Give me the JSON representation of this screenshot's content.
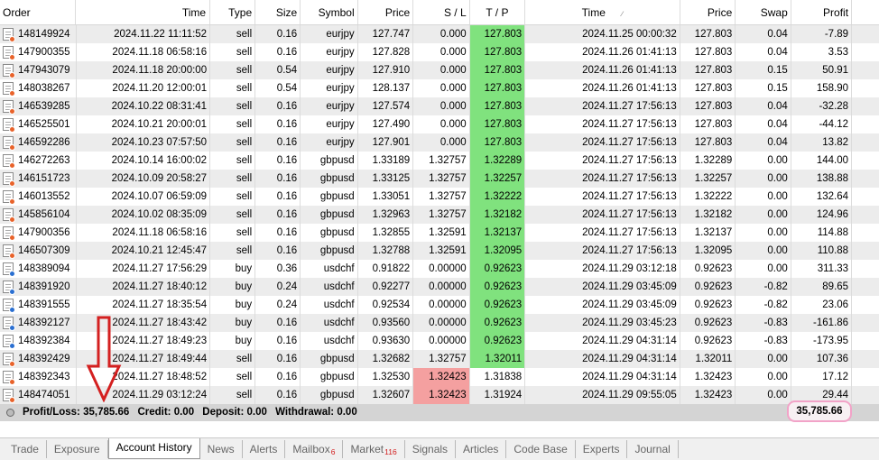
{
  "columns": {
    "order": "Order",
    "open_time": "Time",
    "type": "Type",
    "size": "Size",
    "symbol": "Symbol",
    "open_price": "Price",
    "sl": "S / L",
    "tp": "T / P",
    "close_time": "Time",
    "close_price": "Price",
    "swap": "Swap",
    "profit": "Profit"
  },
  "rows": [
    {
      "order": "148149924",
      "open_time": "2024.11.22 11:11:52",
      "type": "sell",
      "size": "0.16",
      "symbol": "eurjpy",
      "open_price": "127.747",
      "sl": "0.000",
      "tp": "127.803",
      "close_time": "2024.11.25 00:00:32",
      "close_price": "127.803",
      "swap": "0.04",
      "profit": "-7.89",
      "hit": "tp"
    },
    {
      "order": "147900355",
      "open_time": "2024.11.18 06:58:16",
      "type": "sell",
      "size": "0.16",
      "symbol": "eurjpy",
      "open_price": "127.828",
      "sl": "0.000",
      "tp": "127.803",
      "close_time": "2024.11.26 01:41:13",
      "close_price": "127.803",
      "swap": "0.04",
      "profit": "3.53",
      "hit": "tp"
    },
    {
      "order": "147943079",
      "open_time": "2024.11.18 20:00:00",
      "type": "sell",
      "size": "0.54",
      "symbol": "eurjpy",
      "open_price": "127.910",
      "sl": "0.000",
      "tp": "127.803",
      "close_time": "2024.11.26 01:41:13",
      "close_price": "127.803",
      "swap": "0.15",
      "profit": "50.91",
      "hit": "tp"
    },
    {
      "order": "148038267",
      "open_time": "2024.11.20 12:00:01",
      "type": "sell",
      "size": "0.54",
      "symbol": "eurjpy",
      "open_price": "128.137",
      "sl": "0.000",
      "tp": "127.803",
      "close_time": "2024.11.26 01:41:13",
      "close_price": "127.803",
      "swap": "0.15",
      "profit": "158.90",
      "hit": "tp"
    },
    {
      "order": "146539285",
      "open_time": "2024.10.22 08:31:41",
      "type": "sell",
      "size": "0.16",
      "symbol": "eurjpy",
      "open_price": "127.574",
      "sl": "0.000",
      "tp": "127.803",
      "close_time": "2024.11.27 17:56:13",
      "close_price": "127.803",
      "swap": "0.04",
      "profit": "-32.28",
      "hit": "tp"
    },
    {
      "order": "146525501",
      "open_time": "2024.10.21 20:00:01",
      "type": "sell",
      "size": "0.16",
      "symbol": "eurjpy",
      "open_price": "127.490",
      "sl": "0.000",
      "tp": "127.803",
      "close_time": "2024.11.27 17:56:13",
      "close_price": "127.803",
      "swap": "0.04",
      "profit": "-44.12",
      "hit": "tp"
    },
    {
      "order": "146592286",
      "open_time": "2024.10.23 07:57:50",
      "type": "sell",
      "size": "0.16",
      "symbol": "eurjpy",
      "open_price": "127.901",
      "sl": "0.000",
      "tp": "127.803",
      "close_time": "2024.11.27 17:56:13",
      "close_price": "127.803",
      "swap": "0.04",
      "profit": "13.82",
      "hit": "tp"
    },
    {
      "order": "146272263",
      "open_time": "2024.10.14 16:00:02",
      "type": "sell",
      "size": "0.16",
      "symbol": "gbpusd",
      "open_price": "1.33189",
      "sl": "1.32757",
      "tp": "1.32289",
      "close_time": "2024.11.27 17:56:13",
      "close_price": "1.32289",
      "swap": "0.00",
      "profit": "144.00",
      "hit": "tp"
    },
    {
      "order": "146151723",
      "open_time": "2024.10.09 20:58:27",
      "type": "sell",
      "size": "0.16",
      "symbol": "gbpusd",
      "open_price": "1.33125",
      "sl": "1.32757",
      "tp": "1.32257",
      "close_time": "2024.11.27 17:56:13",
      "close_price": "1.32257",
      "swap": "0.00",
      "profit": "138.88",
      "hit": "tp"
    },
    {
      "order": "146013552",
      "open_time": "2024.10.07 06:59:09",
      "type": "sell",
      "size": "0.16",
      "symbol": "gbpusd",
      "open_price": "1.33051",
      "sl": "1.32757",
      "tp": "1.32222",
      "close_time": "2024.11.27 17:56:13",
      "close_price": "1.32222",
      "swap": "0.00",
      "profit": "132.64",
      "hit": "tp"
    },
    {
      "order": "145856104",
      "open_time": "2024.10.02 08:35:09",
      "type": "sell",
      "size": "0.16",
      "symbol": "gbpusd",
      "open_price": "1.32963",
      "sl": "1.32757",
      "tp": "1.32182",
      "close_time": "2024.11.27 17:56:13",
      "close_price": "1.32182",
      "swap": "0.00",
      "profit": "124.96",
      "hit": "tp"
    },
    {
      "order": "147900356",
      "open_time": "2024.11.18 06:58:16",
      "type": "sell",
      "size": "0.16",
      "symbol": "gbpusd",
      "open_price": "1.32855",
      "sl": "1.32591",
      "tp": "1.32137",
      "close_time": "2024.11.27 17:56:13",
      "close_price": "1.32137",
      "swap": "0.00",
      "profit": "114.88",
      "hit": "tp"
    },
    {
      "order": "146507309",
      "open_time": "2024.10.21 12:45:47",
      "type": "sell",
      "size": "0.16",
      "symbol": "gbpusd",
      "open_price": "1.32788",
      "sl": "1.32591",
      "tp": "1.32095",
      "close_time": "2024.11.27 17:56:13",
      "close_price": "1.32095",
      "swap": "0.00",
      "profit": "110.88",
      "hit": "tp"
    },
    {
      "order": "148389094",
      "open_time": "2024.11.27 17:56:29",
      "type": "buy",
      "size": "0.36",
      "symbol": "usdchf",
      "open_price": "0.91822",
      "sl": "0.00000",
      "tp": "0.92623",
      "close_time": "2024.11.29 03:12:18",
      "close_price": "0.92623",
      "swap": "0.00",
      "profit": "311.33",
      "hit": "tp"
    },
    {
      "order": "148391920",
      "open_time": "2024.11.27 18:40:12",
      "type": "buy",
      "size": "0.24",
      "symbol": "usdchf",
      "open_price": "0.92277",
      "sl": "0.00000",
      "tp": "0.92623",
      "close_time": "2024.11.29 03:45:09",
      "close_price": "0.92623",
      "swap": "-0.82",
      "profit": "89.65",
      "hit": "tp"
    },
    {
      "order": "148391555",
      "open_time": "2024.11.27 18:35:54",
      "type": "buy",
      "size": "0.24",
      "symbol": "usdchf",
      "open_price": "0.92534",
      "sl": "0.00000",
      "tp": "0.92623",
      "close_time": "2024.11.29 03:45:09",
      "close_price": "0.92623",
      "swap": "-0.82",
      "profit": "23.06",
      "hit": "tp"
    },
    {
      "order": "148392127",
      "open_time": "2024.11.27 18:43:42",
      "type": "buy",
      "size": "0.16",
      "symbol": "usdchf",
      "open_price": "0.93560",
      "sl": "0.00000",
      "tp": "0.92623",
      "close_time": "2024.11.29 03:45:23",
      "close_price": "0.92623",
      "swap": "-0.83",
      "profit": "-161.86",
      "hit": "tp"
    },
    {
      "order": "148392384",
      "open_time": "2024.11.27 18:49:23",
      "type": "buy",
      "size": "0.16",
      "symbol": "usdchf",
      "open_price": "0.93630",
      "sl": "0.00000",
      "tp": "0.92623",
      "close_time": "2024.11.29 04:31:14",
      "close_price": "0.92623",
      "swap": "-0.83",
      "profit": "-173.95",
      "hit": "tp"
    },
    {
      "order": "148392429",
      "open_time": "2024.11.27 18:49:44",
      "type": "sell",
      "size": "0.16",
      "symbol": "gbpusd",
      "open_price": "1.32682",
      "sl": "1.32757",
      "tp": "1.32011",
      "close_time": "2024.11.29 04:31:14",
      "close_price": "1.32011",
      "swap": "0.00",
      "profit": "107.36",
      "hit": "tp"
    },
    {
      "order": "148392343",
      "open_time": "2024.11.27 18:48:52",
      "type": "sell",
      "size": "0.16",
      "symbol": "gbpusd",
      "open_price": "1.32530",
      "sl": "1.32423",
      "tp": "1.31838",
      "close_time": "2024.11.29 04:31:14",
      "close_price": "1.32423",
      "swap": "0.00",
      "profit": "17.12",
      "hit": "sl"
    },
    {
      "order": "148474051",
      "open_time": "2024.11.29 03:12:24",
      "type": "sell",
      "size": "0.16",
      "symbol": "gbpusd",
      "open_price": "1.32607",
      "sl": "1.32423",
      "tp": "1.31924",
      "close_time": "2024.11.29 09:55:05",
      "close_price": "1.32423",
      "swap": "0.00",
      "profit": "29.44",
      "hit": "sl"
    }
  ],
  "summary": {
    "profit_loss": "Profit/Loss: 35,785.66",
    "credit": "Credit: 0.00",
    "deposit": "Deposit: 0.00",
    "withdrawal": "Withdrawal: 0.00",
    "total_profit": "35,785.66"
  },
  "tabs": [
    {
      "label": "Trade"
    },
    {
      "label": "Exposure"
    },
    {
      "label": "Account History",
      "active": true
    },
    {
      "label": "News"
    },
    {
      "label": "Alerts"
    },
    {
      "label": "Mailbox",
      "badge": "6"
    },
    {
      "label": "Market",
      "badge": "116"
    },
    {
      "label": "Signals"
    },
    {
      "label": "Articles"
    },
    {
      "label": "Code Base"
    },
    {
      "label": "Experts"
    },
    {
      "label": "Journal"
    }
  ],
  "colors": {
    "tp_highlight": "#80e27e",
    "sl_highlight": "#f4a0a0",
    "annotation": "#d42020",
    "total_highlight": "#f2a3c8"
  },
  "icons": {
    "order_icon": "document-icon",
    "buy_marker": "blue-dot-icon",
    "sell_marker": "orange-dot-icon",
    "annotation": "down-arrow-icon"
  }
}
